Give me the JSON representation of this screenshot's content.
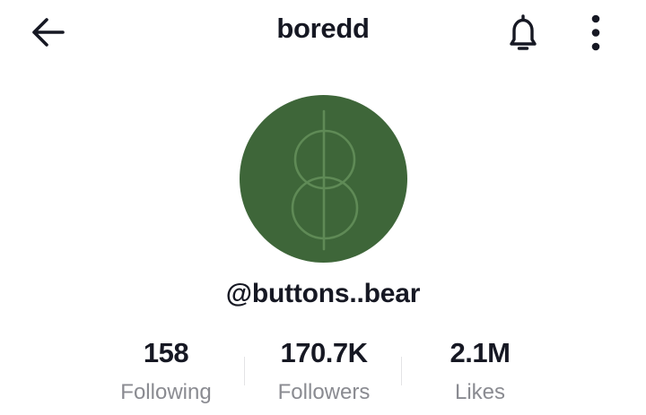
{
  "header": {
    "title": "boredd",
    "back_icon": "arrow-left-icon",
    "bell_icon": "bell-icon",
    "more_icon": "more-vertical-icon"
  },
  "profile": {
    "username": "@buttons..bear",
    "avatar_color": "#3e6639",
    "avatar_icon": "dollar-sign-monogram-icon"
  },
  "stats": [
    {
      "value": "158",
      "label": "Following"
    },
    {
      "value": "170.7K",
      "label": "Followers"
    },
    {
      "value": "2.1M",
      "label": "Likes"
    }
  ],
  "colors": {
    "text": "#161823",
    "muted": "#8a8b91"
  }
}
